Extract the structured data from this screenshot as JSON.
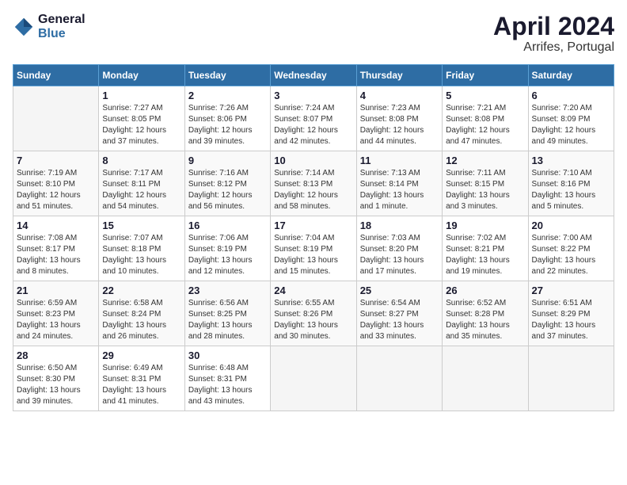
{
  "logo": {
    "line1": "General",
    "line2": "Blue"
  },
  "title": "April 2024",
  "location": "Arrifes, Portugal",
  "weekdays": [
    "Sunday",
    "Monday",
    "Tuesday",
    "Wednesday",
    "Thursday",
    "Friday",
    "Saturday"
  ],
  "weeks": [
    [
      {
        "day": "",
        "empty": true
      },
      {
        "day": "1",
        "sunrise": "Sunrise: 7:27 AM",
        "sunset": "Sunset: 8:05 PM",
        "daylight": "Daylight: 12 hours and 37 minutes."
      },
      {
        "day": "2",
        "sunrise": "Sunrise: 7:26 AM",
        "sunset": "Sunset: 8:06 PM",
        "daylight": "Daylight: 12 hours and 39 minutes."
      },
      {
        "day": "3",
        "sunrise": "Sunrise: 7:24 AM",
        "sunset": "Sunset: 8:07 PM",
        "daylight": "Daylight: 12 hours and 42 minutes."
      },
      {
        "day": "4",
        "sunrise": "Sunrise: 7:23 AM",
        "sunset": "Sunset: 8:08 PM",
        "daylight": "Daylight: 12 hours and 44 minutes."
      },
      {
        "day": "5",
        "sunrise": "Sunrise: 7:21 AM",
        "sunset": "Sunset: 8:08 PM",
        "daylight": "Daylight: 12 hours and 47 minutes."
      },
      {
        "day": "6",
        "sunrise": "Sunrise: 7:20 AM",
        "sunset": "Sunset: 8:09 PM",
        "daylight": "Daylight: 12 hours and 49 minutes."
      }
    ],
    [
      {
        "day": "7",
        "sunrise": "Sunrise: 7:19 AM",
        "sunset": "Sunset: 8:10 PM",
        "daylight": "Daylight: 12 hours and 51 minutes."
      },
      {
        "day": "8",
        "sunrise": "Sunrise: 7:17 AM",
        "sunset": "Sunset: 8:11 PM",
        "daylight": "Daylight: 12 hours and 54 minutes."
      },
      {
        "day": "9",
        "sunrise": "Sunrise: 7:16 AM",
        "sunset": "Sunset: 8:12 PM",
        "daylight": "Daylight: 12 hours and 56 minutes."
      },
      {
        "day": "10",
        "sunrise": "Sunrise: 7:14 AM",
        "sunset": "Sunset: 8:13 PM",
        "daylight": "Daylight: 12 hours and 58 minutes."
      },
      {
        "day": "11",
        "sunrise": "Sunrise: 7:13 AM",
        "sunset": "Sunset: 8:14 PM",
        "daylight": "Daylight: 13 hours and 1 minute."
      },
      {
        "day": "12",
        "sunrise": "Sunrise: 7:11 AM",
        "sunset": "Sunset: 8:15 PM",
        "daylight": "Daylight: 13 hours and 3 minutes."
      },
      {
        "day": "13",
        "sunrise": "Sunrise: 7:10 AM",
        "sunset": "Sunset: 8:16 PM",
        "daylight": "Daylight: 13 hours and 5 minutes."
      }
    ],
    [
      {
        "day": "14",
        "sunrise": "Sunrise: 7:08 AM",
        "sunset": "Sunset: 8:17 PM",
        "daylight": "Daylight: 13 hours and 8 minutes."
      },
      {
        "day": "15",
        "sunrise": "Sunrise: 7:07 AM",
        "sunset": "Sunset: 8:18 PM",
        "daylight": "Daylight: 13 hours and 10 minutes."
      },
      {
        "day": "16",
        "sunrise": "Sunrise: 7:06 AM",
        "sunset": "Sunset: 8:19 PM",
        "daylight": "Daylight: 13 hours and 12 minutes."
      },
      {
        "day": "17",
        "sunrise": "Sunrise: 7:04 AM",
        "sunset": "Sunset: 8:19 PM",
        "daylight": "Daylight: 13 hours and 15 minutes."
      },
      {
        "day": "18",
        "sunrise": "Sunrise: 7:03 AM",
        "sunset": "Sunset: 8:20 PM",
        "daylight": "Daylight: 13 hours and 17 minutes."
      },
      {
        "day": "19",
        "sunrise": "Sunrise: 7:02 AM",
        "sunset": "Sunset: 8:21 PM",
        "daylight": "Daylight: 13 hours and 19 minutes."
      },
      {
        "day": "20",
        "sunrise": "Sunrise: 7:00 AM",
        "sunset": "Sunset: 8:22 PM",
        "daylight": "Daylight: 13 hours and 22 minutes."
      }
    ],
    [
      {
        "day": "21",
        "sunrise": "Sunrise: 6:59 AM",
        "sunset": "Sunset: 8:23 PM",
        "daylight": "Daylight: 13 hours and 24 minutes."
      },
      {
        "day": "22",
        "sunrise": "Sunrise: 6:58 AM",
        "sunset": "Sunset: 8:24 PM",
        "daylight": "Daylight: 13 hours and 26 minutes."
      },
      {
        "day": "23",
        "sunrise": "Sunrise: 6:56 AM",
        "sunset": "Sunset: 8:25 PM",
        "daylight": "Daylight: 13 hours and 28 minutes."
      },
      {
        "day": "24",
        "sunrise": "Sunrise: 6:55 AM",
        "sunset": "Sunset: 8:26 PM",
        "daylight": "Daylight: 13 hours and 30 minutes."
      },
      {
        "day": "25",
        "sunrise": "Sunrise: 6:54 AM",
        "sunset": "Sunset: 8:27 PM",
        "daylight": "Daylight: 13 hours and 33 minutes."
      },
      {
        "day": "26",
        "sunrise": "Sunrise: 6:52 AM",
        "sunset": "Sunset: 8:28 PM",
        "daylight": "Daylight: 13 hours and 35 minutes."
      },
      {
        "day": "27",
        "sunrise": "Sunrise: 6:51 AM",
        "sunset": "Sunset: 8:29 PM",
        "daylight": "Daylight: 13 hours and 37 minutes."
      }
    ],
    [
      {
        "day": "28",
        "sunrise": "Sunrise: 6:50 AM",
        "sunset": "Sunset: 8:30 PM",
        "daylight": "Daylight: 13 hours and 39 minutes."
      },
      {
        "day": "29",
        "sunrise": "Sunrise: 6:49 AM",
        "sunset": "Sunset: 8:31 PM",
        "daylight": "Daylight: 13 hours and 41 minutes."
      },
      {
        "day": "30",
        "sunrise": "Sunrise: 6:48 AM",
        "sunset": "Sunset: 8:31 PM",
        "daylight": "Daylight: 13 hours and 43 minutes."
      },
      {
        "day": "",
        "empty": true
      },
      {
        "day": "",
        "empty": true
      },
      {
        "day": "",
        "empty": true
      },
      {
        "day": "",
        "empty": true
      }
    ]
  ]
}
